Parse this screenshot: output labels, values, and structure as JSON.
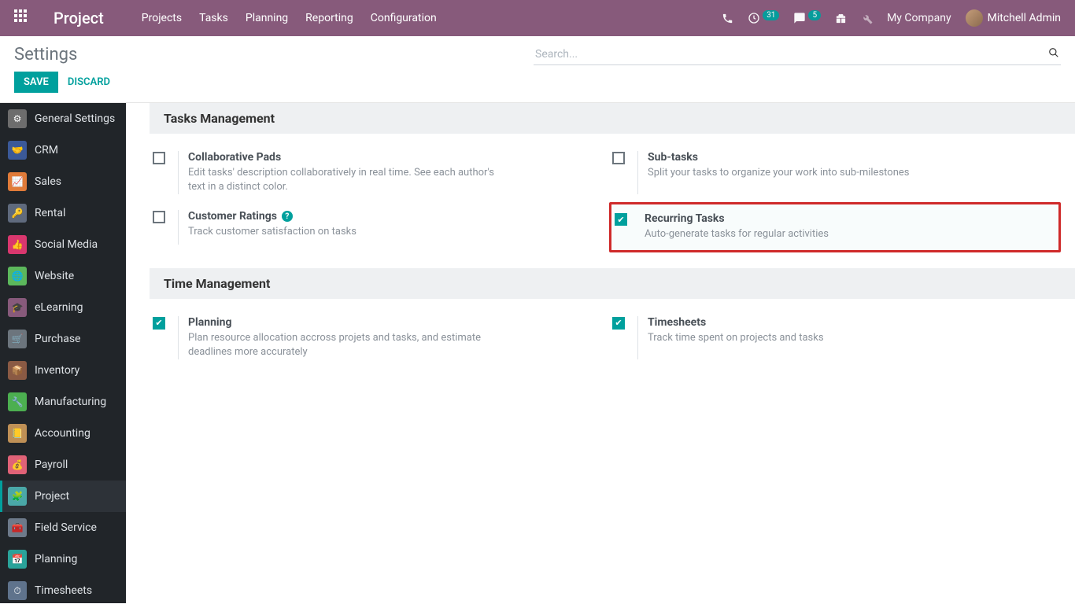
{
  "navbar": {
    "brand": "Project",
    "links": [
      "Projects",
      "Tasks",
      "Planning",
      "Reporting",
      "Configuration"
    ],
    "badges": {
      "activities": "31",
      "messages": "5"
    },
    "company": "My Company",
    "user": "Mitchell Admin"
  },
  "cp": {
    "title": "Settings",
    "search_placeholder": "Search...",
    "save": "SAVE",
    "discard": "DISCARD"
  },
  "sidebar": [
    {
      "label": "General Settings"
    },
    {
      "label": "CRM"
    },
    {
      "label": "Sales"
    },
    {
      "label": "Rental"
    },
    {
      "label": "Social Media"
    },
    {
      "label": "Website"
    },
    {
      "label": "eLearning"
    },
    {
      "label": "Purchase"
    },
    {
      "label": "Inventory"
    },
    {
      "label": "Manufacturing"
    },
    {
      "label": "Accounting"
    },
    {
      "label": "Payroll"
    },
    {
      "label": "Project"
    },
    {
      "label": "Field Service"
    },
    {
      "label": "Planning"
    },
    {
      "label": "Timesheets"
    }
  ],
  "sections": {
    "tasks_mgmt": "Tasks Management",
    "time_mgmt": "Time Management"
  },
  "settings": {
    "collab_pads": {
      "title": "Collaborative Pads",
      "desc": "Edit tasks' description collaboratively in real time. See each author's text in a distinct color."
    },
    "subtasks": {
      "title": "Sub-tasks",
      "desc": "Split your tasks to organize your work into sub-milestones"
    },
    "cust_ratings": {
      "title": "Customer Ratings",
      "desc": "Track customer satisfaction on tasks"
    },
    "recurring": {
      "title": "Recurring Tasks",
      "desc": "Auto-generate tasks for regular activities"
    },
    "planning": {
      "title": "Planning",
      "desc": "Plan resource allocation accross projets and tasks, and estimate deadlines more accurately"
    },
    "timesheets": {
      "title": "Timesheets",
      "desc": "Track time spent on projects and tasks"
    }
  }
}
